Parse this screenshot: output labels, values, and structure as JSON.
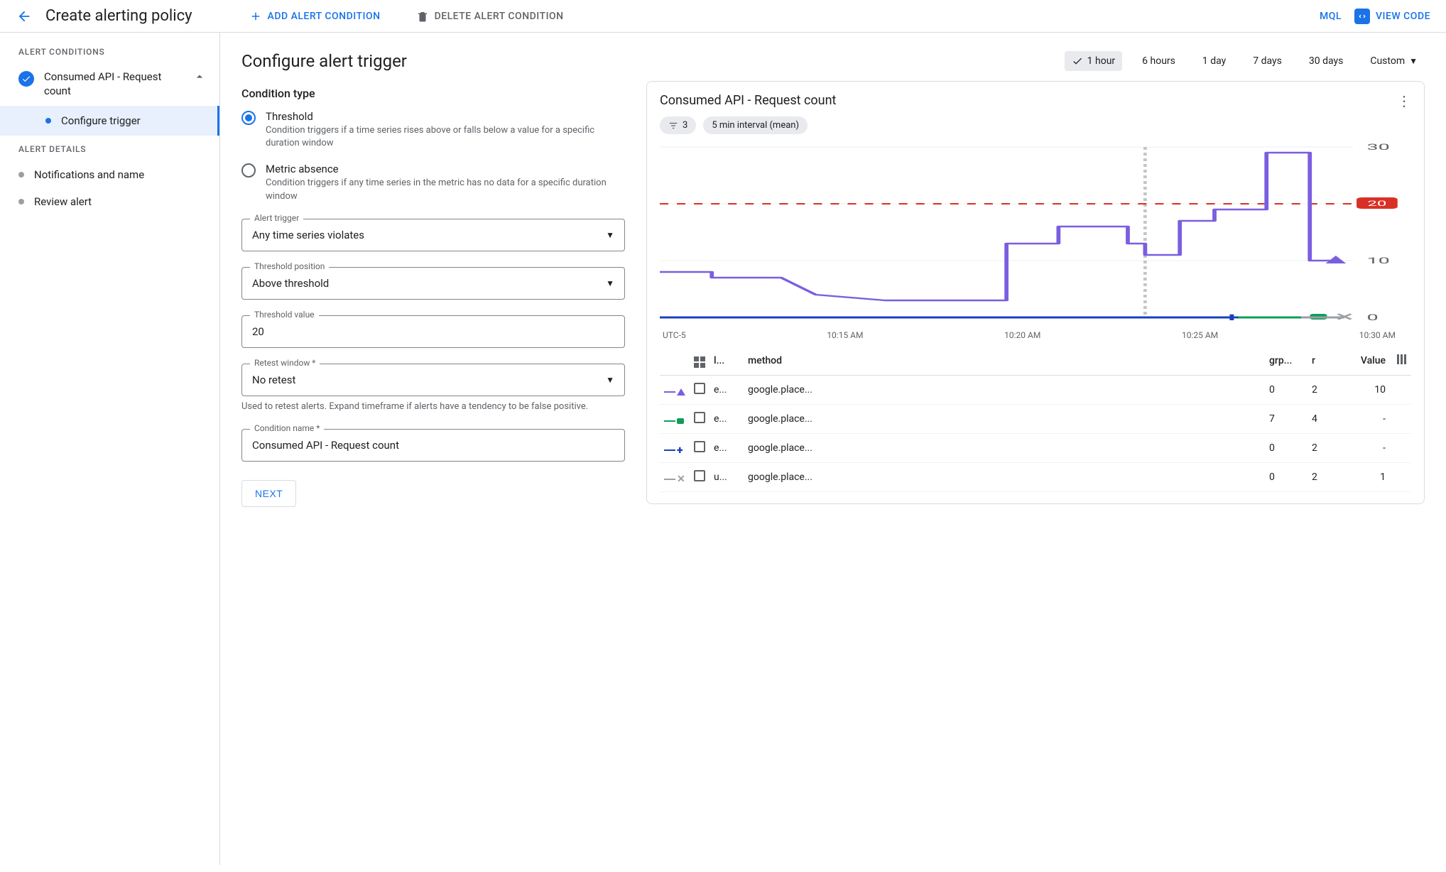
{
  "header": {
    "title": "Create alerting policy",
    "add_condition": "ADD ALERT CONDITION",
    "delete_condition": "DELETE ALERT CONDITION",
    "mql": "MQL",
    "view_code": "VIEW CODE"
  },
  "sidebar": {
    "section_conditions": "ALERT CONDITIONS",
    "condition_name": "Consumed API - Request count",
    "configure_trigger": "Configure trigger",
    "section_details": "ALERT DETAILS",
    "notifications": "Notifications and name",
    "review": "Review alert"
  },
  "form": {
    "heading": "Configure alert trigger",
    "condition_type_label": "Condition type",
    "threshold": {
      "title": "Threshold",
      "desc": "Condition triggers if a time series rises above or falls below a value for a specific duration window"
    },
    "metric_absence": {
      "title": "Metric absence",
      "desc": "Condition triggers if any time series in the metric has no data for a specific duration window"
    },
    "alert_trigger": {
      "label": "Alert trigger",
      "value": "Any time series violates"
    },
    "threshold_position": {
      "label": "Threshold position",
      "value": "Above threshold"
    },
    "threshold_value": {
      "label": "Threshold value",
      "value": "20"
    },
    "retest_window": {
      "label": "Retest window *",
      "value": "No retest",
      "helper": "Used to retest alerts. Expand timeframe if alerts have a tendency to be false positive."
    },
    "condition_name": {
      "label": "Condition name *",
      "value": "Consumed API - Request count"
    },
    "next": "NEXT"
  },
  "time_range": {
    "options": [
      "1 hour",
      "6 hours",
      "1 day",
      "7 days",
      "30 days",
      "Custom"
    ],
    "selected": "1 hour"
  },
  "chart": {
    "title": "Consumed API - Request count",
    "filter_count": "3",
    "interval_chip": "5 min interval (mean)",
    "timezone": "UTC-5",
    "threshold": 20
  },
  "chart_data": {
    "type": "line",
    "ylim": [
      0,
      30
    ],
    "y_ticks": [
      0,
      10,
      20,
      30
    ],
    "x_ticks": [
      "10:15 AM",
      "10:20 AM",
      "10:25 AM",
      "10:30 AM"
    ],
    "threshold": 20,
    "series": [
      {
        "name": "e... google.place... (purple)",
        "color": "#7b5ee0",
        "marker": "triangle",
        "points": [
          {
            "x": 0,
            "y": 8
          },
          {
            "x": 30,
            "y": 8
          },
          {
            "x": 30,
            "y": 7
          },
          {
            "x": 70,
            "y": 7
          },
          {
            "x": 90,
            "y": 4
          },
          {
            "x": 130,
            "y": 3
          },
          {
            "x": 200,
            "y": 3
          },
          {
            "x": 200,
            "y": 13
          },
          {
            "x": 230,
            "y": 13
          },
          {
            "x": 230,
            "y": 16
          },
          {
            "x": 270,
            "y": 16
          },
          {
            "x": 270,
            "y": 13
          },
          {
            "x": 280,
            "y": 13
          },
          {
            "x": 280,
            "y": 11
          },
          {
            "x": 300,
            "y": 11
          },
          {
            "x": 300,
            "y": 17
          },
          {
            "x": 320,
            "y": 17
          },
          {
            "x": 320,
            "y": 19
          },
          {
            "x": 350,
            "y": 19
          },
          {
            "x": 350,
            "y": 29
          },
          {
            "x": 375,
            "y": 29
          },
          {
            "x": 375,
            "y": 10
          },
          {
            "x": 390,
            "y": 10
          }
        ]
      },
      {
        "name": "e... google.place... (green)",
        "color": "#0f9d58",
        "marker": "square",
        "flat_y": 0,
        "x_from": 240,
        "x_to": 380
      },
      {
        "name": "e... google.place... (blue)",
        "color": "#1a3fbf",
        "marker": "plus",
        "flat_y": 0,
        "x_from": 0,
        "x_to": 330
      },
      {
        "name": "u... google.place... (grey-x)",
        "color": "#9aa0a6",
        "marker": "x",
        "flat_y": 0,
        "x_from": 370,
        "x_to": 395
      }
    ]
  },
  "table": {
    "headers": {
      "c1": "l...",
      "c2": "method",
      "c3": "grp...",
      "c4": "r",
      "c5": "Value"
    },
    "rows": [
      {
        "mark": "purple-tri",
        "c1": "e...",
        "c2": "google.place...",
        "c3": "0",
        "c4": "2",
        "value": "10"
      },
      {
        "mark": "green-sq",
        "c1": "e...",
        "c2": "google.place...",
        "c3": "7",
        "c4": "4",
        "value": "-"
      },
      {
        "mark": "blue-plus",
        "c1": "e...",
        "c2": "google.place...",
        "c3": "0",
        "c4": "2",
        "value": "-"
      },
      {
        "mark": "grey-x",
        "c1": "u...",
        "c2": "google.place...",
        "c3": "0",
        "c4": "2",
        "value": "1"
      }
    ]
  }
}
